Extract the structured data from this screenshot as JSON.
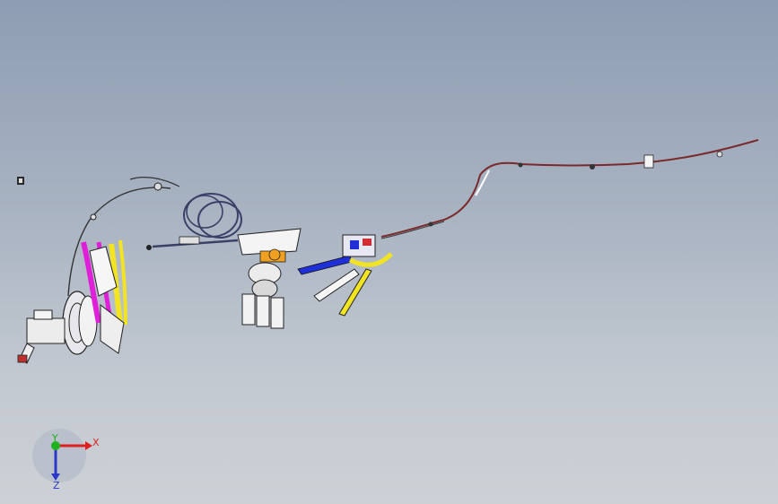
{
  "viewport": {
    "background_top": "#8e9db3",
    "background_bottom": "#cdd1d6"
  },
  "triad": {
    "x_label": "X",
    "y_label": "Y",
    "z_label": "Z",
    "x_color": "#e02020",
    "y_color": "#1fb21f",
    "z_color": "#2b39c8"
  },
  "model": {
    "accent_magenta": "#e020d8",
    "accent_yellow": "#f2e422",
    "accent_blue": "#2030d8",
    "accent_orange": "#f0a020",
    "cable_dark": "#3a4068",
    "cable_brown": "#7a2a2a"
  }
}
